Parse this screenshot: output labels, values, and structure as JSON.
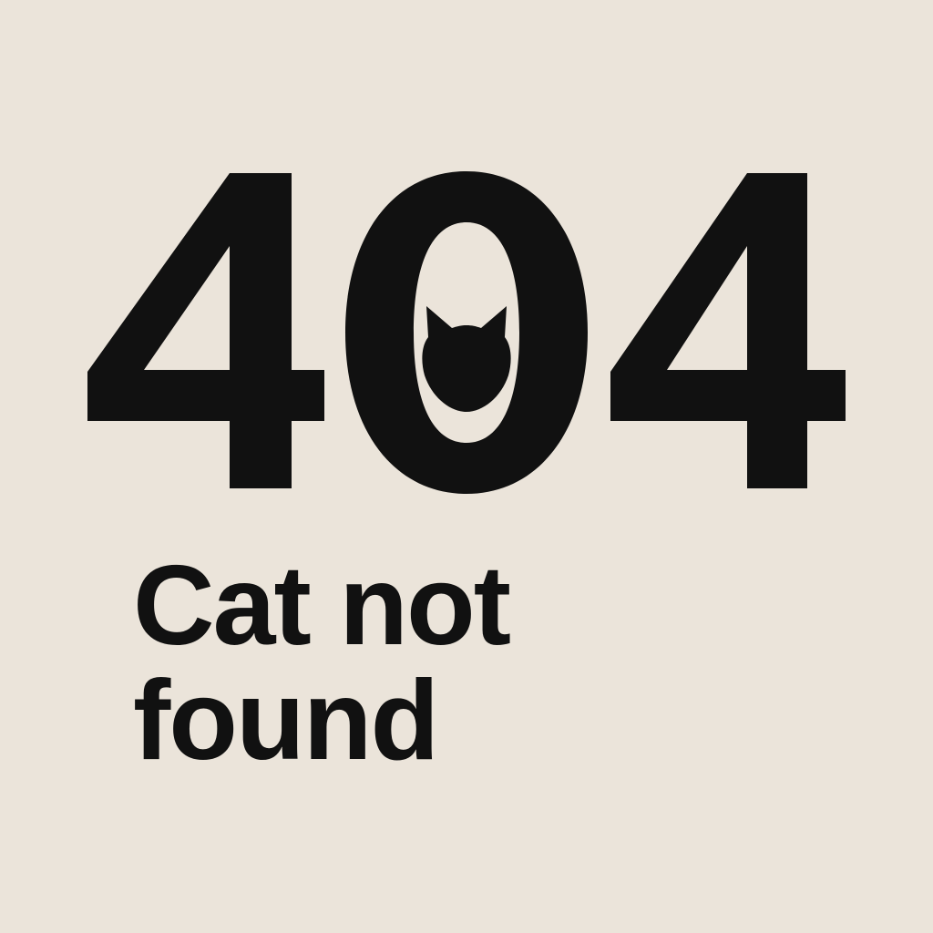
{
  "error": {
    "code_digits": [
      "4",
      "0",
      "4"
    ],
    "message_lines": [
      "Cat not",
      "found"
    ],
    "icon": "cat-head-icon"
  },
  "colors": {
    "background": "#ebe4da",
    "ink": "#111111"
  }
}
